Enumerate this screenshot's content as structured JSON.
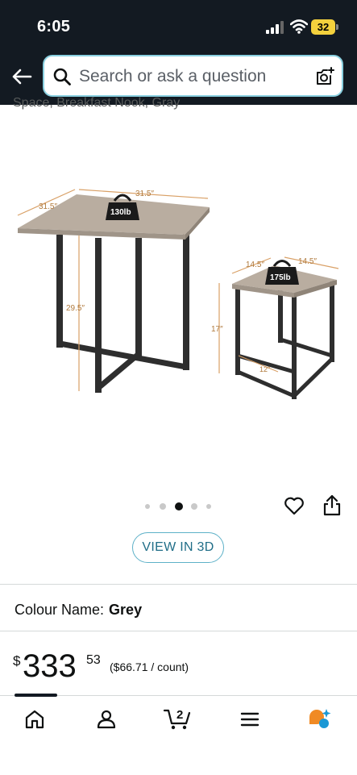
{
  "status_bar": {
    "time": "6:05",
    "battery": "32"
  },
  "search": {
    "placeholder": "Search or ask a question"
  },
  "product": {
    "title_fragment": "Space, Breakfast Nook, Gray",
    "image": {
      "large_table": {
        "width_label": "31.5″",
        "depth_label": "31.5″",
        "height_label": "29.5″",
        "weight_label": "130lb"
      },
      "small_table": {
        "width_label": "14.5″",
        "depth_label": "14.5″",
        "height_label": "17″",
        "inner_label": "12″",
        "weight_label": "175lb"
      }
    },
    "carousel": {
      "count": 5,
      "active_index": 2
    },
    "view_3d_label": "VIEW IN 3D",
    "colour": {
      "label": "Colour Name:",
      "value": "Grey"
    },
    "price": {
      "symbol": "$",
      "whole": "333",
      "fraction": "53",
      "unit_price": "($66.71 / count)"
    }
  },
  "bottom_nav": {
    "items": [
      {
        "name": "home",
        "icon": "home-icon"
      },
      {
        "name": "account",
        "icon": "person-icon"
      },
      {
        "name": "cart",
        "icon": "cart-icon",
        "badge": "2"
      },
      {
        "name": "menu",
        "icon": "menu-icon"
      },
      {
        "name": "rufus",
        "icon": "ai-chat-icon"
      }
    ]
  },
  "colors": {
    "header_bg": "#131a22",
    "accent_teal": "#1f6d87",
    "amazon_orange": "#f08a24",
    "wood": "#b9ada0"
  }
}
